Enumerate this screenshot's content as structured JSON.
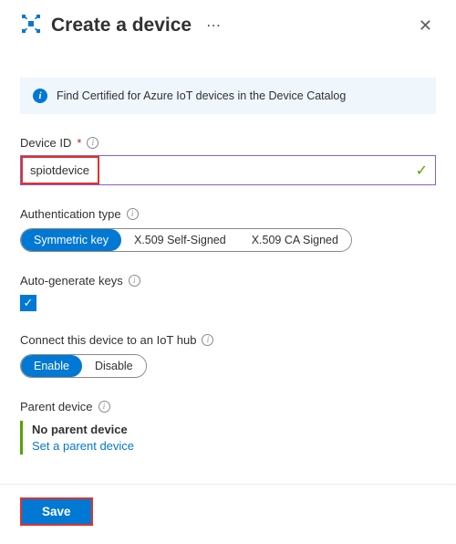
{
  "header": {
    "title": "Create a device"
  },
  "info": {
    "text": "Find Certified for Azure IoT devices in the Device Catalog"
  },
  "deviceId": {
    "label": "Device ID",
    "value": "spiotdevice"
  },
  "authType": {
    "label": "Authentication type",
    "options": [
      "Symmetric key",
      "X.509 Self-Signed",
      "X.509 CA Signed"
    ],
    "selected": 0
  },
  "autoGen": {
    "label": "Auto-generate keys",
    "checked": true
  },
  "connect": {
    "label": "Connect this device to an IoT hub",
    "options": [
      "Enable",
      "Disable"
    ],
    "selected": 0
  },
  "parent": {
    "label": "Parent device",
    "statusText": "No parent device",
    "linkText": "Set a parent device"
  },
  "footer": {
    "save": "Save"
  }
}
